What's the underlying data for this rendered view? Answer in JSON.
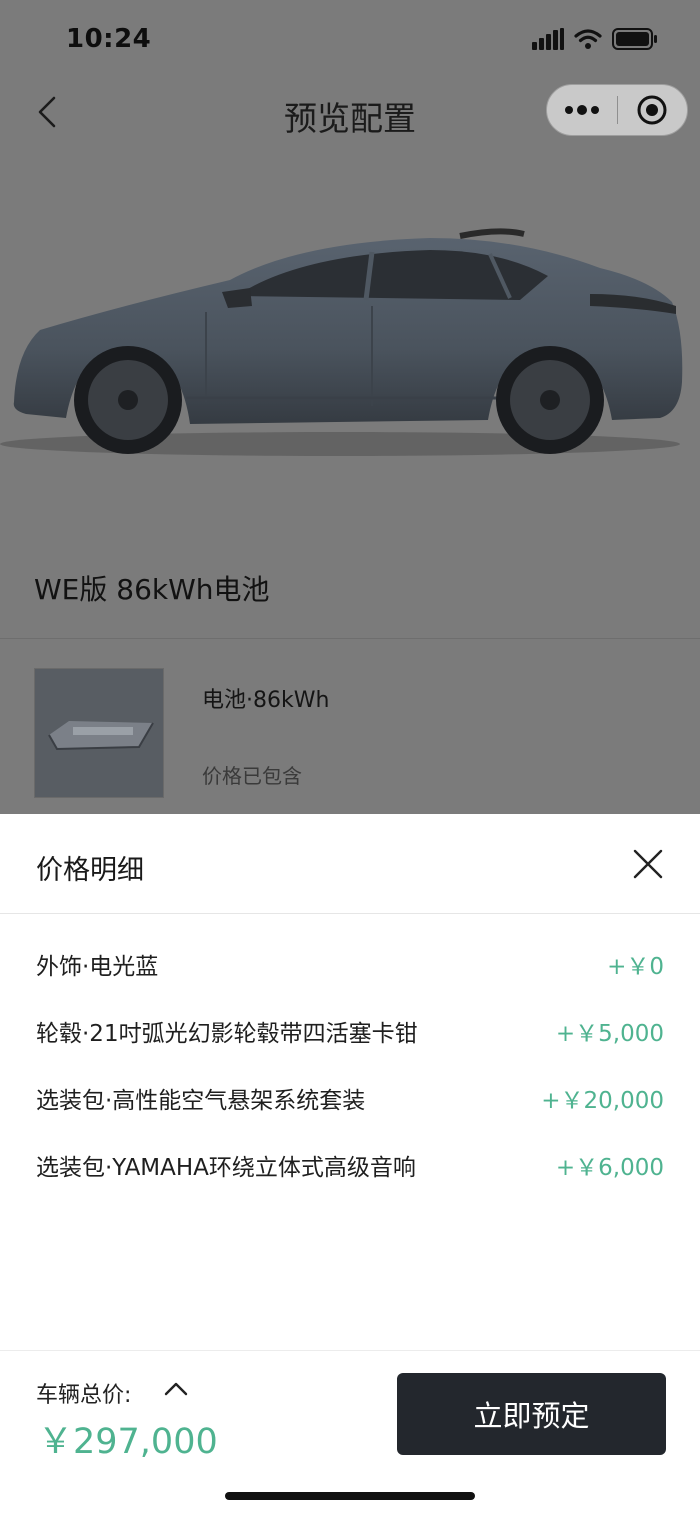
{
  "status_bar": {
    "time": "10:24"
  },
  "nav": {
    "title": "预览配置",
    "more_icon": "more-dots-icon",
    "target_icon": "target-circle-icon",
    "back_icon": "chevron-left-icon"
  },
  "config": {
    "name": "WE版 86kWh电池",
    "battery": {
      "name": "电池·86kWh",
      "note": "价格已包含"
    }
  },
  "price_sheet": {
    "title": "价格明细",
    "items": [
      {
        "label": "外饰·电光蓝",
        "amount": "+￥0"
      },
      {
        "label": "轮毂·21吋弧光幻影轮毂带四活塞卡钳",
        "amount": "+￥5,000"
      },
      {
        "label": "选装包·高性能空气悬架系统套装",
        "amount": "+￥20,000"
      },
      {
        "label": "选装包·YAMAHA环绕立体式高级音响",
        "amount": "+￥6,000"
      }
    ]
  },
  "footer": {
    "total_label": "车辆总价:",
    "total_value": "￥297,000",
    "reserve_label": "立即预定"
  },
  "colors": {
    "accent_green": "#4fb390",
    "button_dark": "#23272d",
    "overlay": "#7b7b7b"
  }
}
